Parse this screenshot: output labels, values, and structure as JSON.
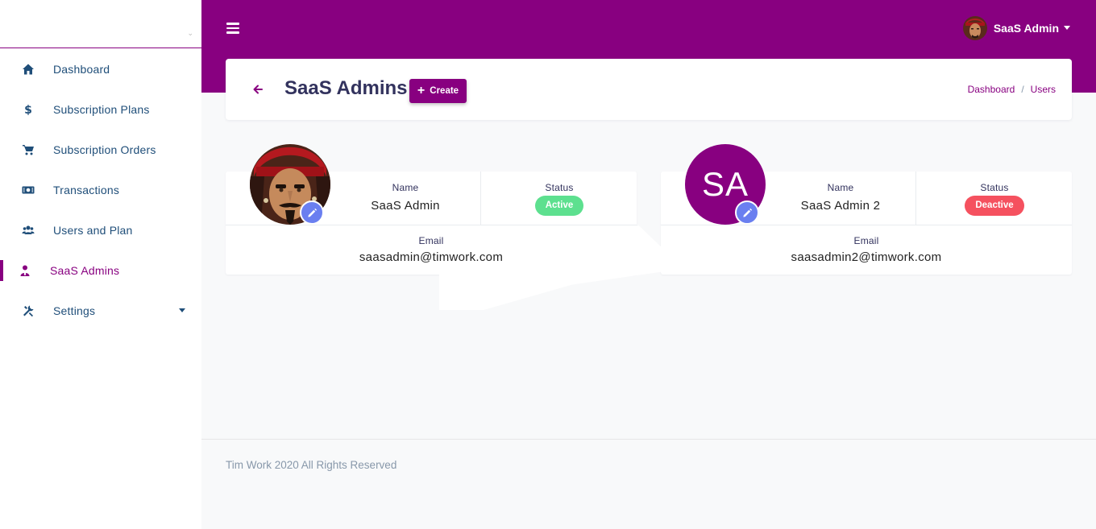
{
  "sidebar": {
    "brand_hint": "⌄",
    "items": [
      {
        "label": "Dashboard",
        "icon": "home-icon"
      },
      {
        "label": "Subscription Plans",
        "icon": "dollar-icon"
      },
      {
        "label": "Subscription Orders",
        "icon": "cart-icon"
      },
      {
        "label": "Transactions",
        "icon": "money-icon"
      },
      {
        "label": "Users and Plan",
        "icon": "users-icon"
      },
      {
        "label": "SaaS Admins",
        "icon": "user-tie-icon",
        "active": true
      },
      {
        "label": "Settings",
        "icon": "tools-icon",
        "has_submenu": true
      }
    ]
  },
  "topbar": {
    "user_name": "SaaS Admin",
    "accent": "#880080"
  },
  "header": {
    "title": "SaaS Admins",
    "create_label": "Create",
    "breadcrumb": [
      "Dashboard",
      "Users"
    ],
    "breadcrumb_sep": "/"
  },
  "admins": [
    {
      "name_label": "Name",
      "name": "SaaS Admin",
      "status_label": "Status",
      "status": "Active",
      "status_color": "#5de08f",
      "email_label": "Email",
      "email": "saasadmin@timwork.com",
      "avatar": "photo"
    },
    {
      "name_label": "Name",
      "name": "SaaS Admin 2",
      "status_label": "Status",
      "status": "Deactive",
      "status_color": "#f5515f",
      "email_label": "Email",
      "email": "saasadmin2@timwork.com",
      "avatar_initials": "SA"
    }
  ],
  "footer": {
    "text": "Tim Work 2020 All Rights Reserved"
  }
}
